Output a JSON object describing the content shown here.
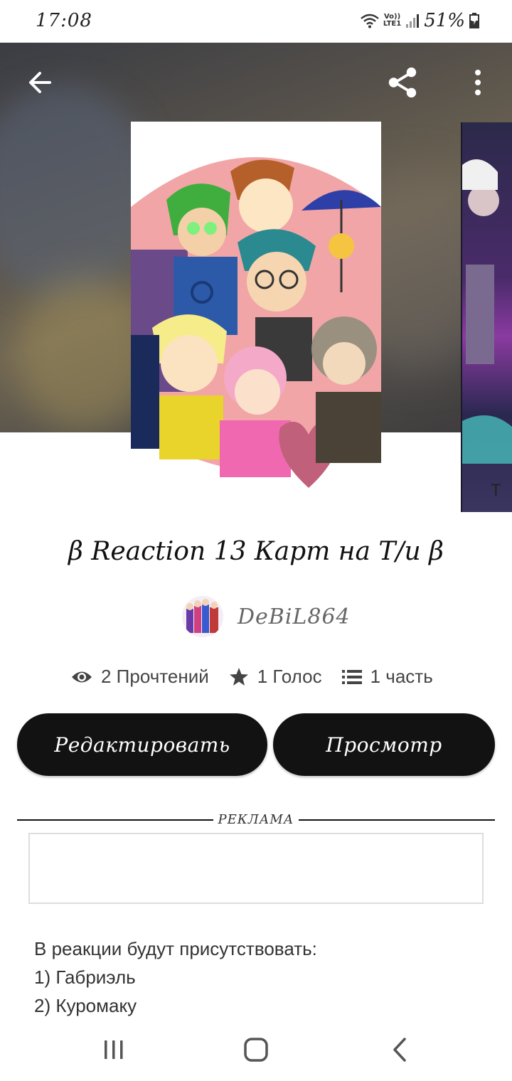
{
  "status_bar": {
    "time": "17:08",
    "network_top": "Vo))",
    "network_bottom": "LTE1",
    "battery": "51%"
  },
  "icons": {
    "back": "arrow-left-icon",
    "share": "share-icon",
    "more": "more-vertical-icon",
    "reads": "eye-icon",
    "votes": "star-icon",
    "parts": "list-icon"
  },
  "story": {
    "title": "β Reaction 13 Карт на Т/и β",
    "author": "DeBiL864",
    "stats": {
      "reads": "2 Прочтений",
      "votes": "1 Голос",
      "parts": "1 часть"
    }
  },
  "actions": {
    "edit_label": "Редактировать",
    "preview_label": "Просмотр"
  },
  "ad": {
    "label": "РЕКЛАМА"
  },
  "description": {
    "lines": [
      "В реакции будут присутствовать:",
      "1) Габриэль",
      "2) Куромаку"
    ]
  },
  "colors": {
    "button_bg": "#121212",
    "button_text": "#ffffff"
  }
}
